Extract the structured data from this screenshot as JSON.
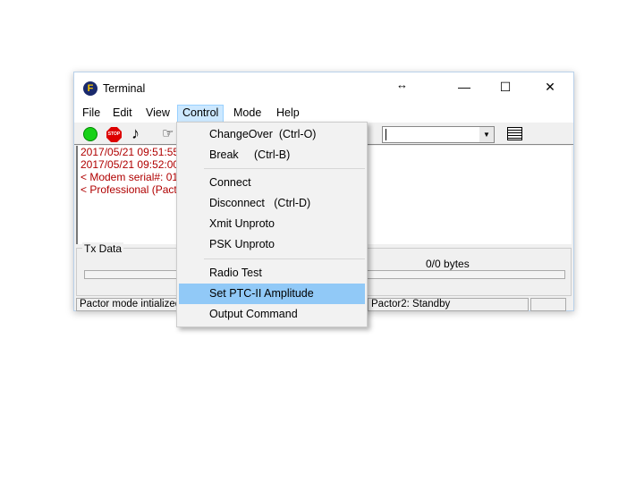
{
  "window": {
    "title": "Terminal",
    "resize_glyph": "↔",
    "minimize": "—",
    "maximize": "☐",
    "close": "✕"
  },
  "menubar": [
    "File",
    "Edit",
    "View",
    "Control",
    "Mode",
    "Help"
  ],
  "toolbar": {
    "icons": [
      "green-light-icon",
      "stop-icon",
      "music-note-icon",
      "hand-icon",
      "list-icon"
    ],
    "stop_text": "STOP",
    "combo_value": ""
  },
  "log": [
    "2017/05/21 09:51:55",
    "2017/05/21 09:52:00",
    "< Modem serial#: 010",
    "< Professional (Pactor"
  ],
  "tx": {
    "label": "Tx Data",
    "bytes": "0/0 bytes",
    "progress": 0
  },
  "status": [
    "Pactor mode intialized",
    "",
    "Pactor2: Standby",
    ""
  ],
  "control_menu": [
    {
      "label": "ChangeOver  (Ctrl-O)"
    },
    {
      "label": "Break     (Ctrl-B)"
    },
    {
      "label": "Connect"
    },
    {
      "label": "Disconnect   (Ctrl-D)"
    },
    {
      "label": "Xmit Unproto"
    },
    {
      "label": "PSK Unproto"
    },
    {
      "label": "Radio Test"
    },
    {
      "label": "Set PTC-II Amplitude",
      "highlighted": true
    },
    {
      "label": "Output Command"
    }
  ]
}
